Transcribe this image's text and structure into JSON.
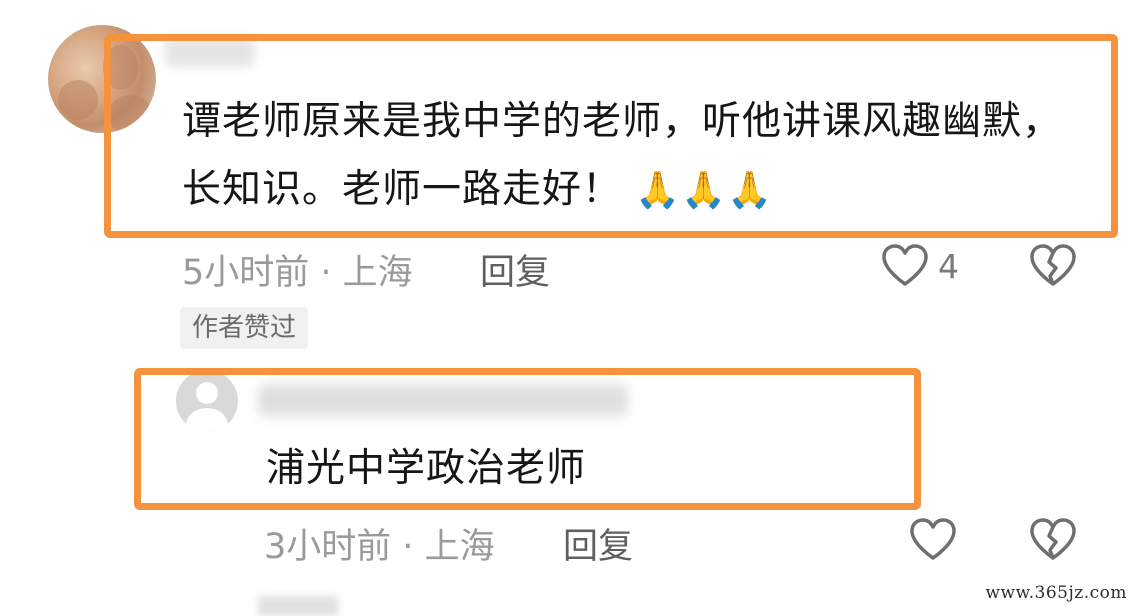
{
  "comments": [
    {
      "text": "谭老师原来是我中学的老师，听他讲课风趣幽默，长知识。老师一路走好！",
      "emoji": "🙏🙏🙏",
      "time_location": "5小时前 · 上海",
      "reply_label": "回复",
      "like_count": "4",
      "badge": "作者赞过"
    },
    {
      "text": "浦光中学政治老师",
      "time_location": "3小时前 · 上海",
      "reply_label": "回复"
    }
  ],
  "watermark": "www.365jz.com",
  "colors": {
    "highlight": "#f5923e",
    "meta_text": "#9a9a9a"
  },
  "icons": [
    "heart-icon",
    "broken-heart-icon",
    "default-avatar-icon"
  ]
}
